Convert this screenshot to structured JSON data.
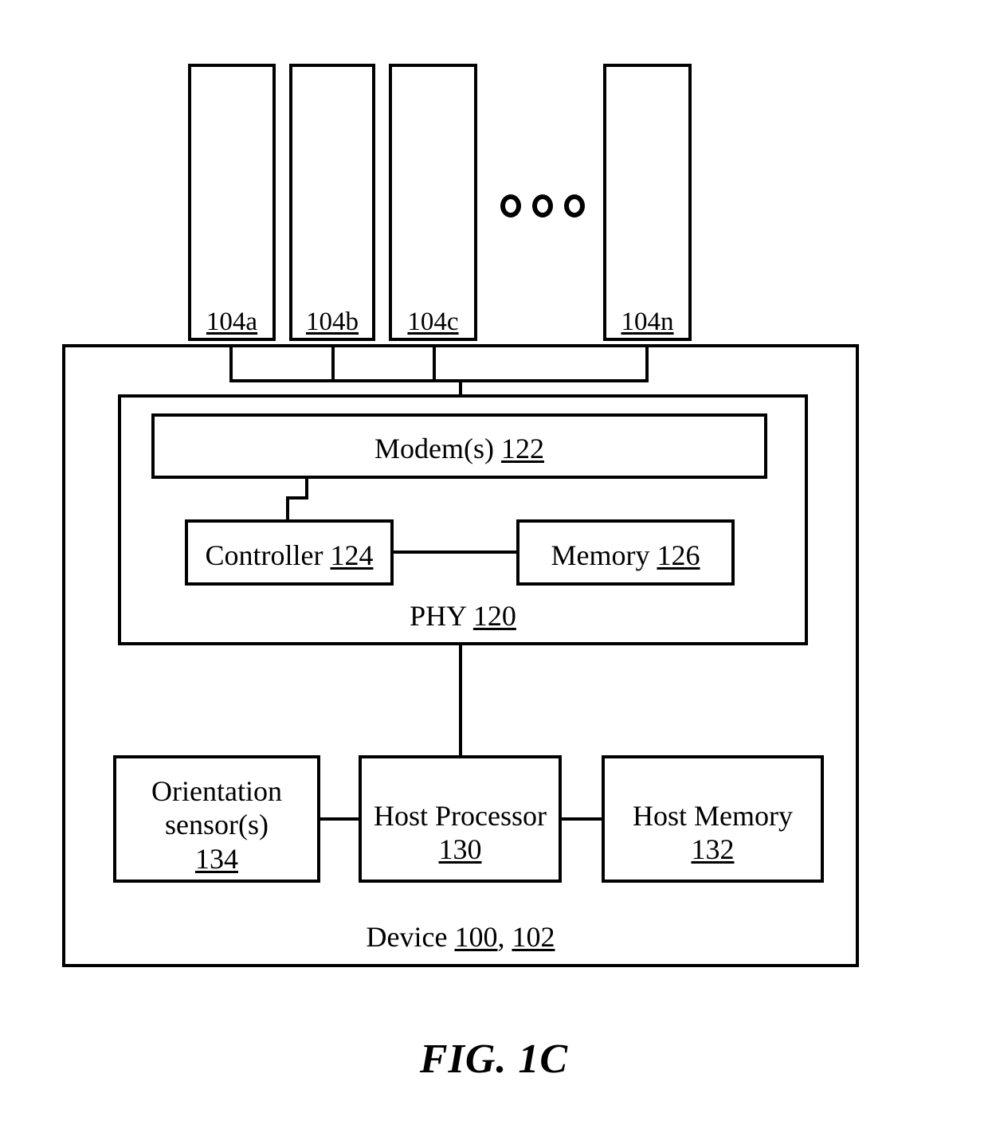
{
  "figure": {
    "caption": "FIG. 1C",
    "type": "patent-block-diagram"
  },
  "antennas": [
    {
      "label": "104a",
      "id": "antenna-104a"
    },
    {
      "label": "104b",
      "id": "antenna-104b"
    },
    {
      "label": "104c",
      "id": "antenna-104c"
    },
    {
      "label": "104n",
      "id": "antenna-104n"
    }
  ],
  "ellipsis": {
    "name": "ellipsis-dots",
    "count": 3,
    "meaning": "additional antennas omitted"
  },
  "device": {
    "label_text": "Device ",
    "ref_1": "100",
    "separator": ", ",
    "ref_2": "102"
  },
  "phy": {
    "label_text": "PHY ",
    "ref": "120"
  },
  "blocks": {
    "modem": {
      "label_text": "Modem(s) ",
      "ref": "122"
    },
    "controller": {
      "label_text": "Controller ",
      "ref": "124"
    },
    "memory": {
      "label_text": "Memory ",
      "ref": "126"
    },
    "orientation_sensor": {
      "line1": "Orientation",
      "line2": "sensor(s)",
      "ref": "134"
    },
    "host_processor": {
      "line1": "Host Processor",
      "ref": "130"
    },
    "host_memory": {
      "line1": "Host Memory",
      "ref": "132"
    }
  },
  "colors": {
    "stroke": "#000000",
    "background": "#ffffff"
  }
}
